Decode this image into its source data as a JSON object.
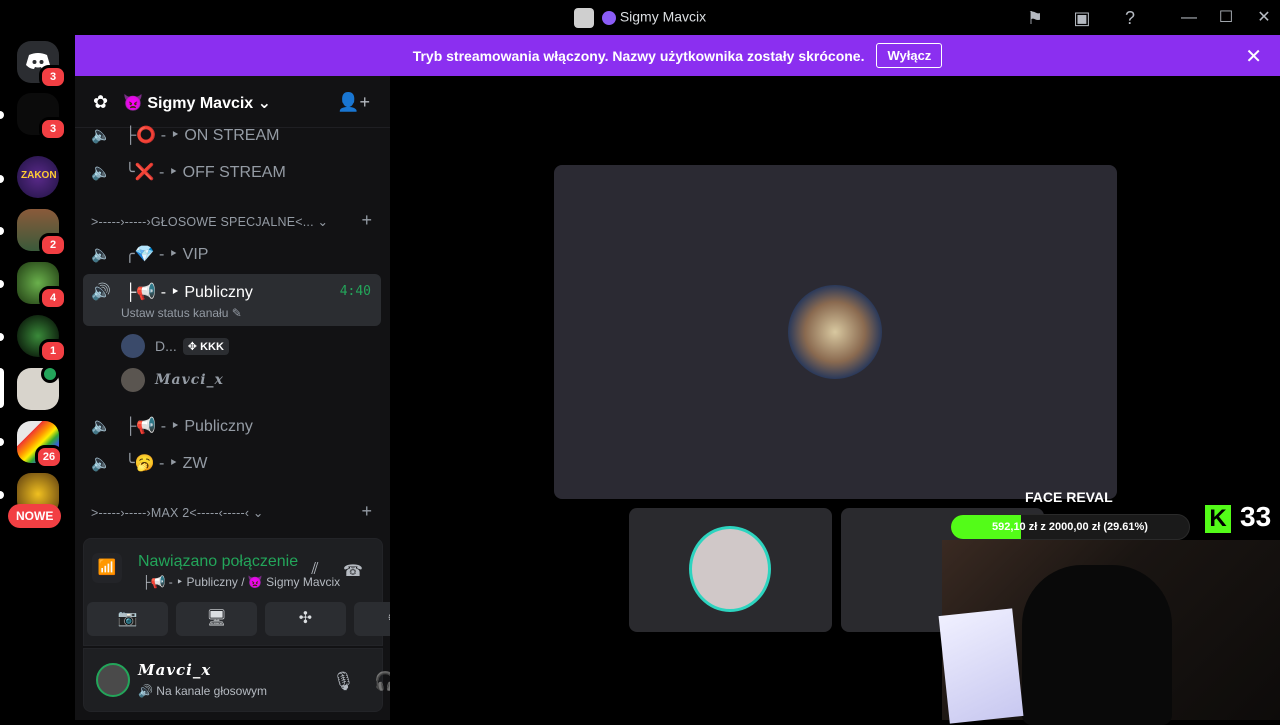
{
  "window": {
    "title": "Sigmy Mavcix",
    "icons": [
      "flag-icon",
      "inbox-icon",
      "help-icon",
      "minimize-icon",
      "maximize-icon",
      "close-icon"
    ]
  },
  "banner": {
    "message": "Tryb streamowania włączony. Nazwy użytkownika zostały skrócone.",
    "button_label": "Wyłącz"
  },
  "rail": {
    "servers": [
      {
        "name": "discord-home",
        "badge": "3"
      },
      {
        "name": "server-2",
        "badge": "3"
      },
      {
        "name": "server-zakon",
        "badge": ""
      },
      {
        "name": "server-4",
        "badge": "2"
      },
      {
        "name": "server-5",
        "badge": "4"
      },
      {
        "name": "server-6",
        "badge": "1"
      },
      {
        "name": "server-7",
        "badge": ""
      },
      {
        "name": "server-8",
        "badge": "26"
      },
      {
        "name": "server-9",
        "badge": ""
      }
    ],
    "new_label": "NOWE"
  },
  "guild": {
    "name": "Sigmy Mavcix"
  },
  "channels": {
    "on_stream": "├⭕ - ‣ ON STREAM",
    "off_stream": "╰❌ - ‣ OFF STREAM",
    "category_special": ">-----›-----›GŁOSOWE SPECJALNE<...",
    "vip": "╭💎 - ‣ VIP",
    "public_active": "├📢 - ‣ Publiczny",
    "public_active_time": "4:40",
    "public_active_status": "Ustaw status kanału",
    "member_1_name": "D...",
    "member_1_tag": "KKK",
    "member_2_name": "𝑴𝒂𝒗𝒄𝒊_𝒙",
    "public_2": "├📢 - ‣ Publiczny",
    "zw": "╰🥱 - ‣ ZW",
    "category_max": ">-----›-----›MAX 2<-----‹-----‹"
  },
  "voice": {
    "status": "Nawiązano połączenie",
    "location": "├📢 - ‣ Publiczny / 👿 Sigmy Mavcix"
  },
  "user": {
    "name": "𝑴𝒂𝒗𝒄𝒊_𝒙",
    "status": "Na kanale głosowym"
  },
  "overlay": {
    "title": "FACE REVAL",
    "goal_text": "592,10 zł z 2000,00 zł (29.61%)",
    "goal_progress": 0.2961,
    "viewer_count": "33",
    "kick_logo": "K"
  }
}
